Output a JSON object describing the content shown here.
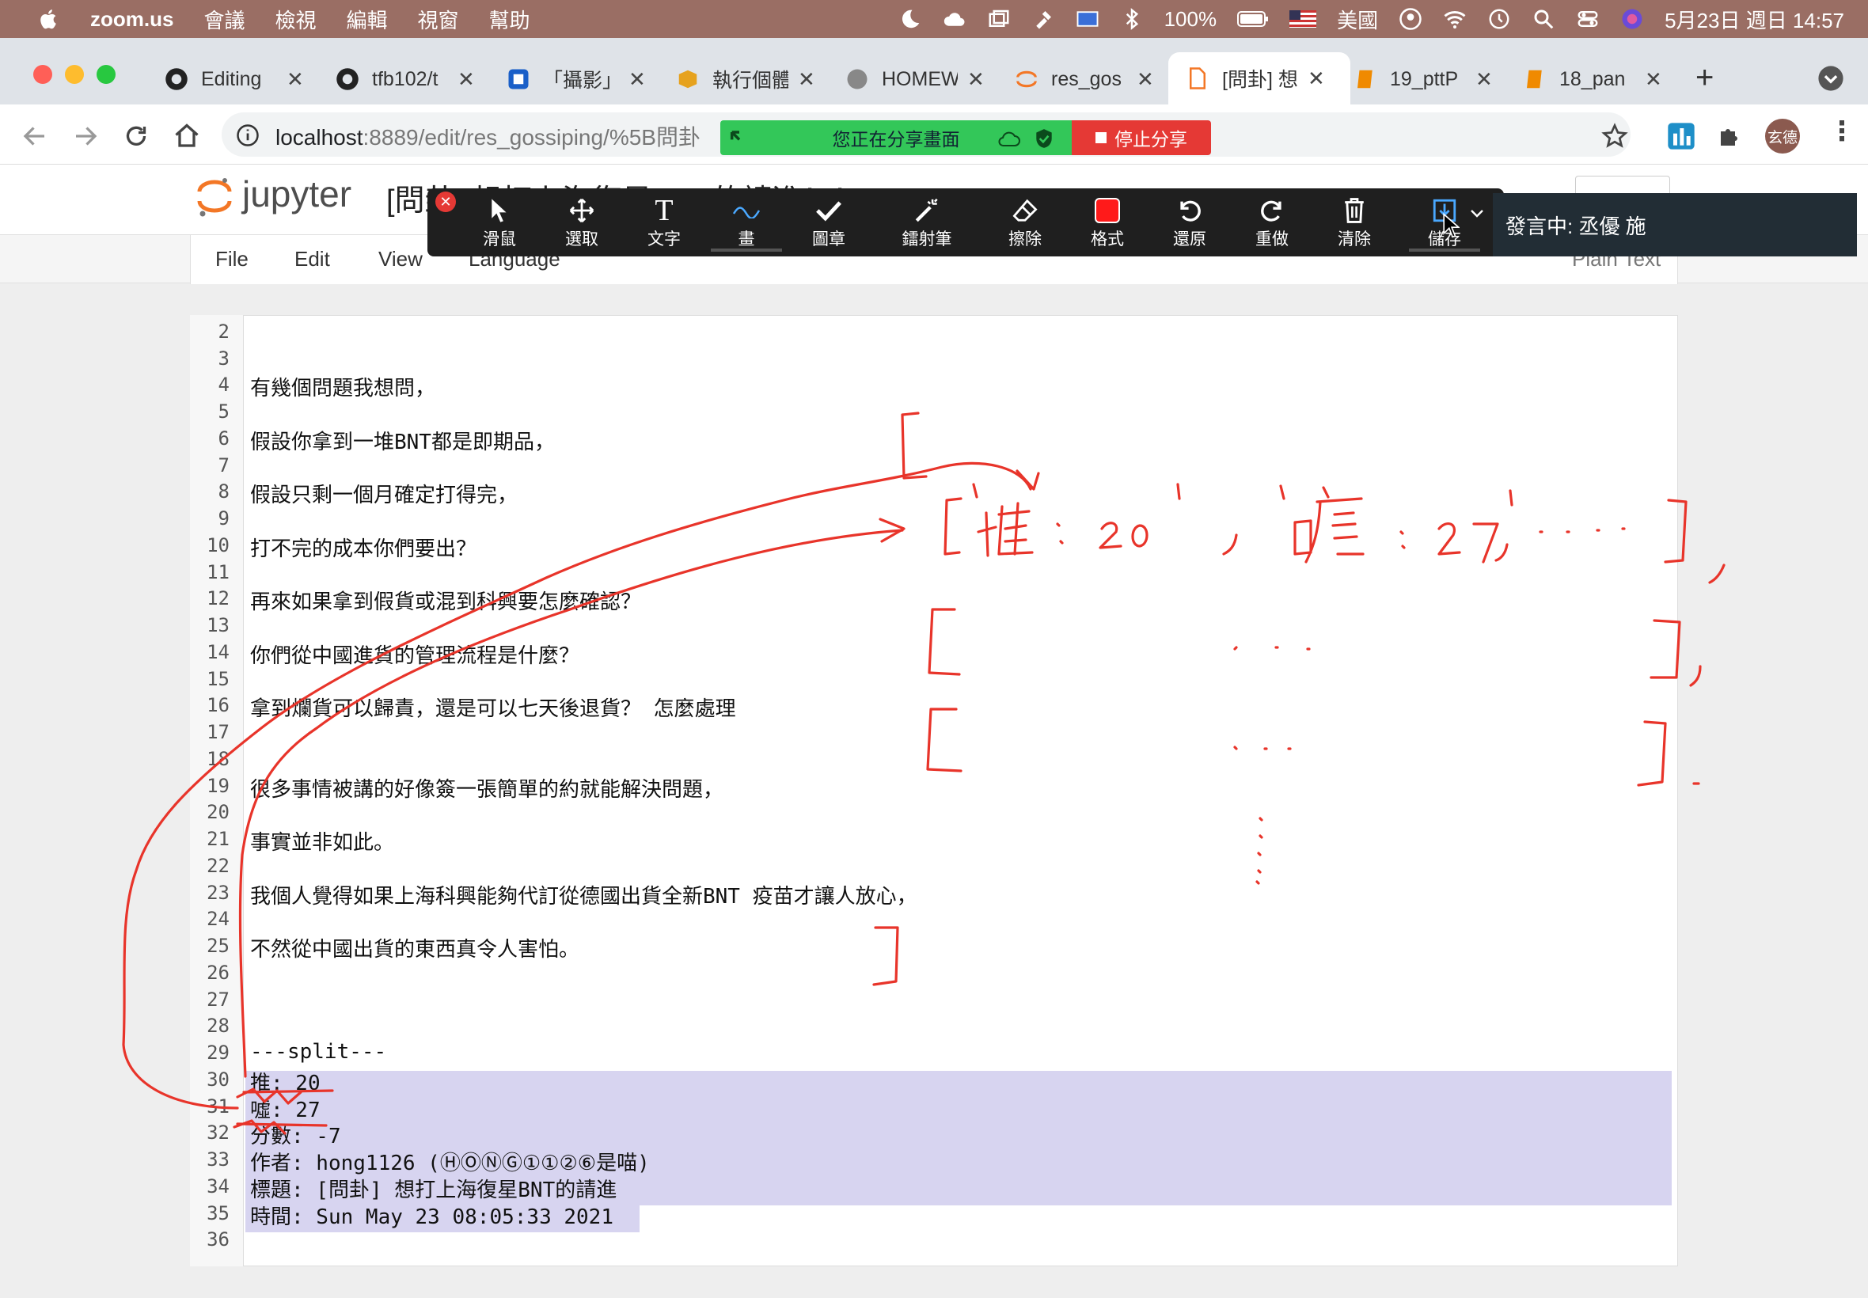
{
  "menubar": {
    "app": "zoom.us",
    "items": [
      "會議",
      "檢視",
      "編輯",
      "視窗",
      "幫助"
    ],
    "battery": "100%",
    "input_lang": "美國",
    "datetime": "5月23日 週日 14:57"
  },
  "tabs": [
    {
      "label": "Editing",
      "icon": "github-icon"
    },
    {
      "label": "tfb102/t",
      "icon": "github-icon"
    },
    {
      "label": "「攝影」",
      "icon": "blue-doc-icon"
    },
    {
      "label": "執行個體",
      "icon": "box-icon"
    },
    {
      "label": "HOMEW",
      "icon": "globe-icon"
    },
    {
      "label": "res_gos",
      "icon": "jupyter-icon"
    },
    {
      "label": "[問卦] 想",
      "icon": "file-icon"
    },
    {
      "label": "19_pttP",
      "icon": "notebook-icon"
    },
    {
      "label": "18_pan",
      "icon": "notebook-icon"
    }
  ],
  "address": {
    "host": "localhost",
    "path": ":8889/edit/res_gossiping/%5B問卦"
  },
  "share_banner": {
    "status": "您正在分享畫面",
    "stop": "停止分享"
  },
  "profile_label": "玄德",
  "jupyter": {
    "logo": "jupyter",
    "title": "[問卦] 想打上海復星BNT的請進！！",
    "menu": [
      "File",
      "Edit",
      "View",
      "Language"
    ],
    "mode": "Plain Text"
  },
  "annotation_tools": [
    "滑鼠",
    "選取",
    "文字",
    "畫",
    "圖章",
    "鐳射筆",
    "擦除",
    "格式",
    "還原",
    "重做",
    "清除",
    "儲存"
  ],
  "presenter": "發言中: 丞優 施",
  "editor_lines": [
    {
      "n": "2",
      "t": ""
    },
    {
      "n": "3",
      "t": ""
    },
    {
      "n": "4",
      "t": "有幾個問題我想問，"
    },
    {
      "n": "5",
      "t": ""
    },
    {
      "n": "6",
      "t": "假設你拿到一堆BNT都是即期品，"
    },
    {
      "n": "7",
      "t": ""
    },
    {
      "n": "8",
      "t": "假設只剩一個月確定打得完，"
    },
    {
      "n": "9",
      "t": ""
    },
    {
      "n": "10",
      "t": "打不完的成本你們要出？"
    },
    {
      "n": "11",
      "t": ""
    },
    {
      "n": "12",
      "t": "再來如果拿到假貨或混到科興要怎麼確認？"
    },
    {
      "n": "13",
      "t": ""
    },
    {
      "n": "14",
      "t": "你們從中國進貨的管理流程是什麼？"
    },
    {
      "n": "15",
      "t": ""
    },
    {
      "n": "16",
      "t": "拿到爛貨可以歸責，還是可以七天後退貨？  怎麼處理"
    },
    {
      "n": "17",
      "t": ""
    },
    {
      "n": "18",
      "t": ""
    },
    {
      "n": "19",
      "t": "很多事情被講的好像簽一張簡單的約就能解決問題，"
    },
    {
      "n": "20",
      "t": ""
    },
    {
      "n": "21",
      "t": "事實並非如此。"
    },
    {
      "n": "22",
      "t": ""
    },
    {
      "n": "23",
      "t": "我個人覺得如果上海科興能夠代訂從德國出貨全新BNT 疫苗才讓人放心，"
    },
    {
      "n": "24",
      "t": ""
    },
    {
      "n": "25",
      "t": "不然從中國出貨的東西真令人害怕。"
    },
    {
      "n": "26",
      "t": ""
    },
    {
      "n": "27",
      "t": ""
    },
    {
      "n": "28",
      "t": ""
    },
    {
      "n": "29",
      "t": "---split---"
    },
    {
      "n": "30",
      "t": "推: 20"
    },
    {
      "n": "31",
      "t": "噓: 27"
    },
    {
      "n": "32",
      "t": "分數: -7"
    },
    {
      "n": "33",
      "t": "作者: hong1126 (ⒽⓄⓃⒼ①①②⑥是喵)"
    },
    {
      "n": "34",
      "t": "標題: [問卦]   想打上海復星BNT的請進"
    },
    {
      "n": "35",
      "t": "時間: Sun May 23 08:05:33 2021"
    },
    {
      "n": "36",
      "t": ""
    }
  ],
  "colors": {
    "ink": "#e8342a",
    "selection": "#d7d4f0",
    "share_green": "#33c759",
    "share_red": "#e53935"
  }
}
